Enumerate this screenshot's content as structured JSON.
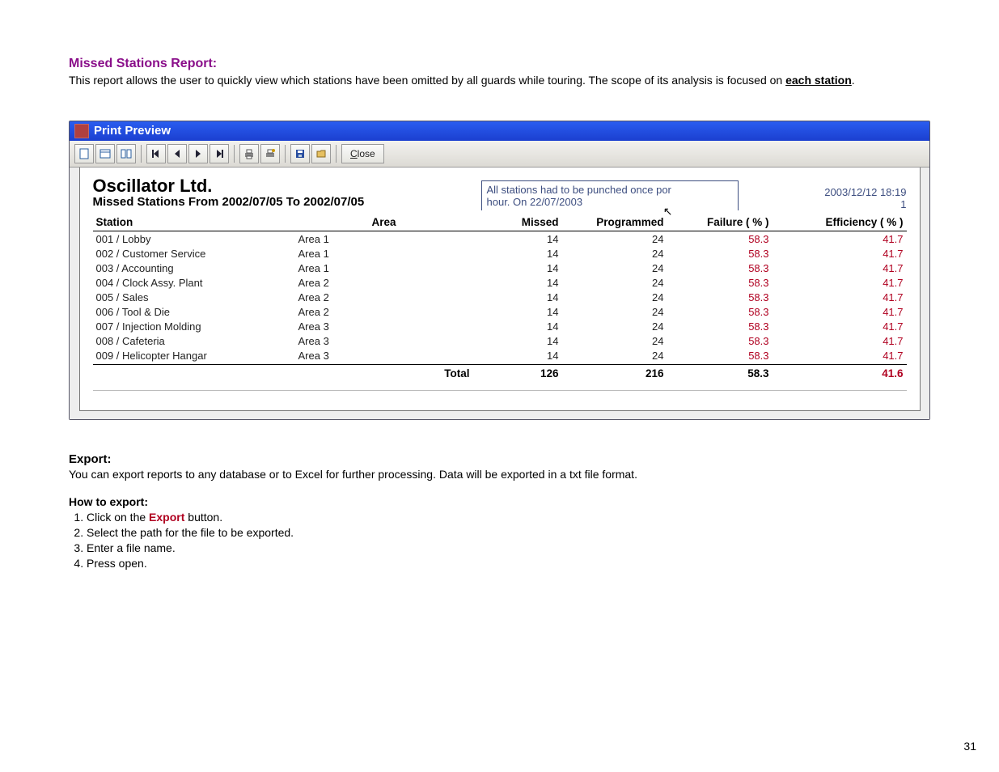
{
  "doc": {
    "section_title": "Missed Stations Report:",
    "intro_before": "This report allows the user to quickly view which stations have been omitted by all guards while touring. The scope of its analysis is focused on ",
    "intro_under": "each station",
    "intro_after": "."
  },
  "window": {
    "title": "Print Preview",
    "close_label": "lose",
    "close_prefix": "C"
  },
  "report": {
    "company": "Oscillator Ltd.",
    "subtitle": "Missed Stations From 2002/07/05 To 2002/07/05",
    "note_line1": "All stations had to be punched once por",
    "note_line2": "hour. On 22/07/2003",
    "timestamp": "2003/12/12 18:19",
    "page_no": "1",
    "columns": {
      "station": "Station",
      "area": "Area",
      "missed": "Missed",
      "programmed": "Programmed",
      "failure": "Failure ( % )",
      "efficiency": "Efficiency ( % )"
    },
    "rows": [
      {
        "station": "001 / Lobby",
        "area": "Area 1",
        "missed": "14",
        "prog": "24",
        "fail": "58.3",
        "eff": "41.7"
      },
      {
        "station": "002 / Customer Service",
        "area": "Area 1",
        "missed": "14",
        "prog": "24",
        "fail": "58.3",
        "eff": "41.7"
      },
      {
        "station": "003 / Accounting",
        "area": "Area 1",
        "missed": "14",
        "prog": "24",
        "fail": "58.3",
        "eff": "41.7"
      },
      {
        "station": "004 / Clock Assy. Plant",
        "area": "Area 2",
        "missed": "14",
        "prog": "24",
        "fail": "58.3",
        "eff": "41.7"
      },
      {
        "station": "005 / Sales",
        "area": "Area 2",
        "missed": "14",
        "prog": "24",
        "fail": "58.3",
        "eff": "41.7"
      },
      {
        "station": "006 / Tool & Die",
        "area": "Area 2",
        "missed": "14",
        "prog": "24",
        "fail": "58.3",
        "eff": "41.7"
      },
      {
        "station": "007 / Injection Molding",
        "area": "Area 3",
        "missed": "14",
        "prog": "24",
        "fail": "58.3",
        "eff": "41.7"
      },
      {
        "station": "008 / Cafeteria",
        "area": "Area 3",
        "missed": "14",
        "prog": "24",
        "fail": "58.3",
        "eff": "41.7"
      },
      {
        "station": "009 / Helicopter Hangar",
        "area": "Area 3",
        "missed": "14",
        "prog": "24",
        "fail": "58.3",
        "eff": "41.7"
      }
    ],
    "total": {
      "label": "Total",
      "missed": "126",
      "prog": "216",
      "fail": "58.3",
      "eff": "41.6"
    }
  },
  "export": {
    "title": "Export:",
    "desc": "You can export reports to any database or to Excel for further processing. Data will be exported in a txt file format."
  },
  "howto": {
    "title": "How to export:",
    "step1_before": "Click on the ",
    "step1_hl": "Export",
    "step1_after": " button.",
    "step2": "Select the path for the file to be exported.",
    "step3": "Enter a file name.",
    "step4": "Press open."
  },
  "footer": {
    "page": "31"
  }
}
